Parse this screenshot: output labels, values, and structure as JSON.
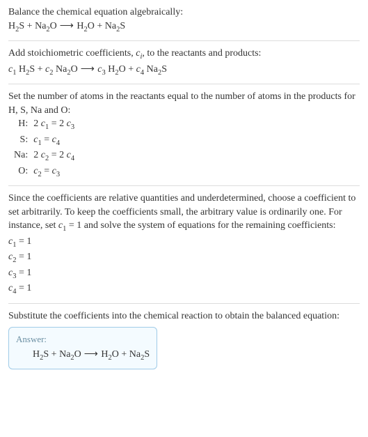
{
  "intro": {
    "text": "Balance the chemical equation algebraically:"
  },
  "reaction_plain": {
    "r1a": "H",
    "r1b": "S",
    "r2a": "Na",
    "r2b": "O",
    "p1a": "H",
    "p1b": "O",
    "p2a": "Na",
    "p2b": "S",
    "plus": " + ",
    "arrow": " ⟶ "
  },
  "stoich": {
    "intro_a": "Add stoichiometric coefficients, ",
    "ci": "c",
    "ci_sub": "i",
    "intro_b": ", to the reactants and products:",
    "c1": "c",
    "c1s": "1",
    "c2": "c",
    "c2s": "2",
    "c3": "c",
    "c3s": "3",
    "c4": "c",
    "c4s": "4",
    "sp": " "
  },
  "atoms": {
    "intro": "Set the number of atoms in the reactants equal to the number of atoms in the products for H, S, Na and O:",
    "rows": [
      {
        "label": "H:",
        "lhs_coef": "2 ",
        "lhs_c": "c",
        "lhs_s": "1",
        "eq": " = ",
        "rhs_coef": "2 ",
        "rhs_c": "c",
        "rhs_s": "3"
      },
      {
        "label": "S:",
        "lhs_coef": "",
        "lhs_c": "c",
        "lhs_s": "1",
        "eq": " = ",
        "rhs_coef": "",
        "rhs_c": "c",
        "rhs_s": "4"
      },
      {
        "label": "Na:",
        "lhs_coef": "2 ",
        "lhs_c": "c",
        "lhs_s": "2",
        "eq": " = ",
        "rhs_coef": "2 ",
        "rhs_c": "c",
        "rhs_s": "4"
      },
      {
        "label": "O:",
        "lhs_coef": "",
        "lhs_c": "c",
        "lhs_s": "2",
        "eq": " = ",
        "rhs_coef": "",
        "rhs_c": "c",
        "rhs_s": "3"
      }
    ]
  },
  "solve": {
    "para_a": "Since the coefficients are relative quantities and underdetermined, choose a coefficient to set arbitrarily. To keep the coefficients small, the arbitrary value is ordinarily one. For instance, set ",
    "c": "c",
    "s": "1",
    "para_b": " = 1 and solve the system of equations for the remaining coefficients:",
    "l1a": "c",
    "l1s": "1",
    "l1b": " = 1",
    "l2a": "c",
    "l2s": "2",
    "l2b": " = 1",
    "l3a": "c",
    "l3s": "3",
    "l3b": " = 1",
    "l4a": "c",
    "l4s": "4",
    "l4b": " = 1"
  },
  "subst": {
    "text": "Substitute the coefficients into the chemical reaction to obtain the balanced equation:"
  },
  "answer": {
    "label": "Answer:"
  }
}
